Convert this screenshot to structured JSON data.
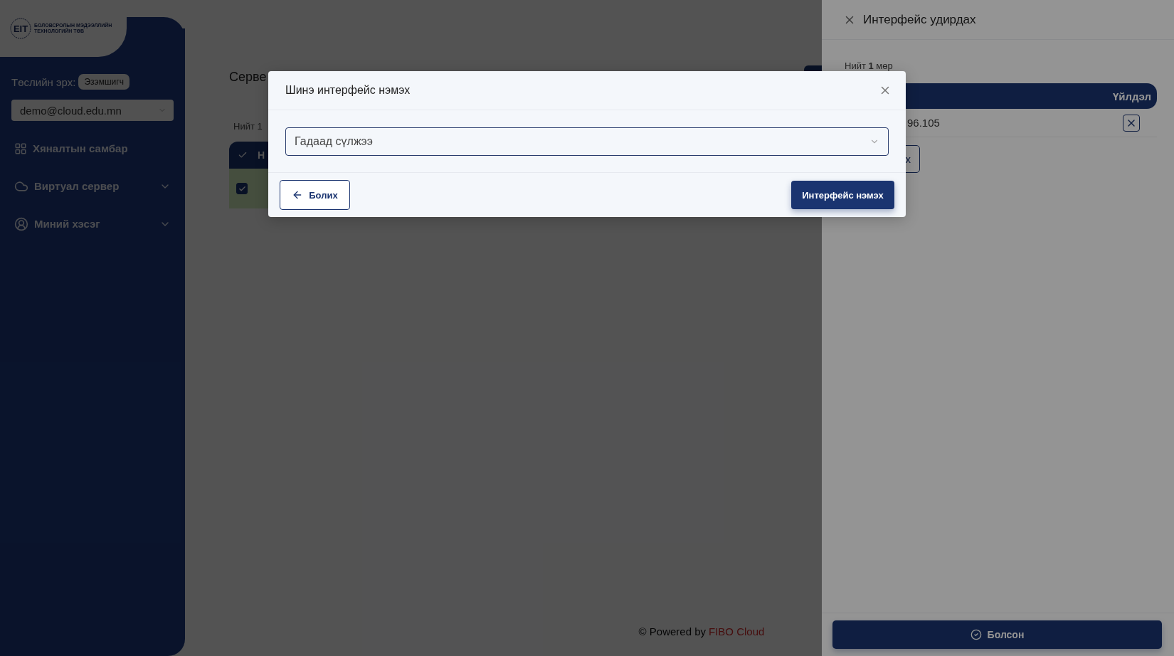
{
  "sidebar": {
    "logo": {
      "mark": "EIT",
      "lines": [
        "БОЛОВСРОЛЫН МЭДЭЭЛЛИЙН",
        "ТЕХНОЛОГИЙН ТӨВ"
      ]
    },
    "role": {
      "label": "Төслийн эрх:",
      "badge": "Эзэмшигч"
    },
    "account_select": {
      "value": "demo@cloud.edu.mn"
    },
    "items": [
      {
        "label": "Хяналтын самбар",
        "kind": "dashboard",
        "has_submenu": false
      },
      {
        "label": "Виртуал сервер",
        "kind": "cloud",
        "has_submenu": true
      },
      {
        "label": "Миний хэсэг",
        "kind": "user",
        "has_submenu": true
      }
    ]
  },
  "main": {
    "title": "Серве",
    "total": "Нийт 1",
    "table": {
      "header": "Н",
      "rows": [
        {
          "checked": true
        }
      ]
    }
  },
  "footer": {
    "prefix": "© Powered by",
    "brand": "FIBO Cloud"
  },
  "drawer": {
    "title": "Интерфейс удирдах",
    "total": {
      "prefix": "Нийт",
      "count": "1",
      "suffix": "мөр"
    },
    "table": {
      "action_column": "Үйлдэл",
      "rows": [
        {
          "address": "96.105"
        }
      ]
    },
    "add_button": "х",
    "done_button": "Болсон"
  },
  "modal": {
    "title": "Шинэ интерфейс нэмэх",
    "select": {
      "value": "Гадаад сүлжээ"
    },
    "cancel_button": "Болих",
    "submit_button": "Интерфейс нэмэх"
  }
}
